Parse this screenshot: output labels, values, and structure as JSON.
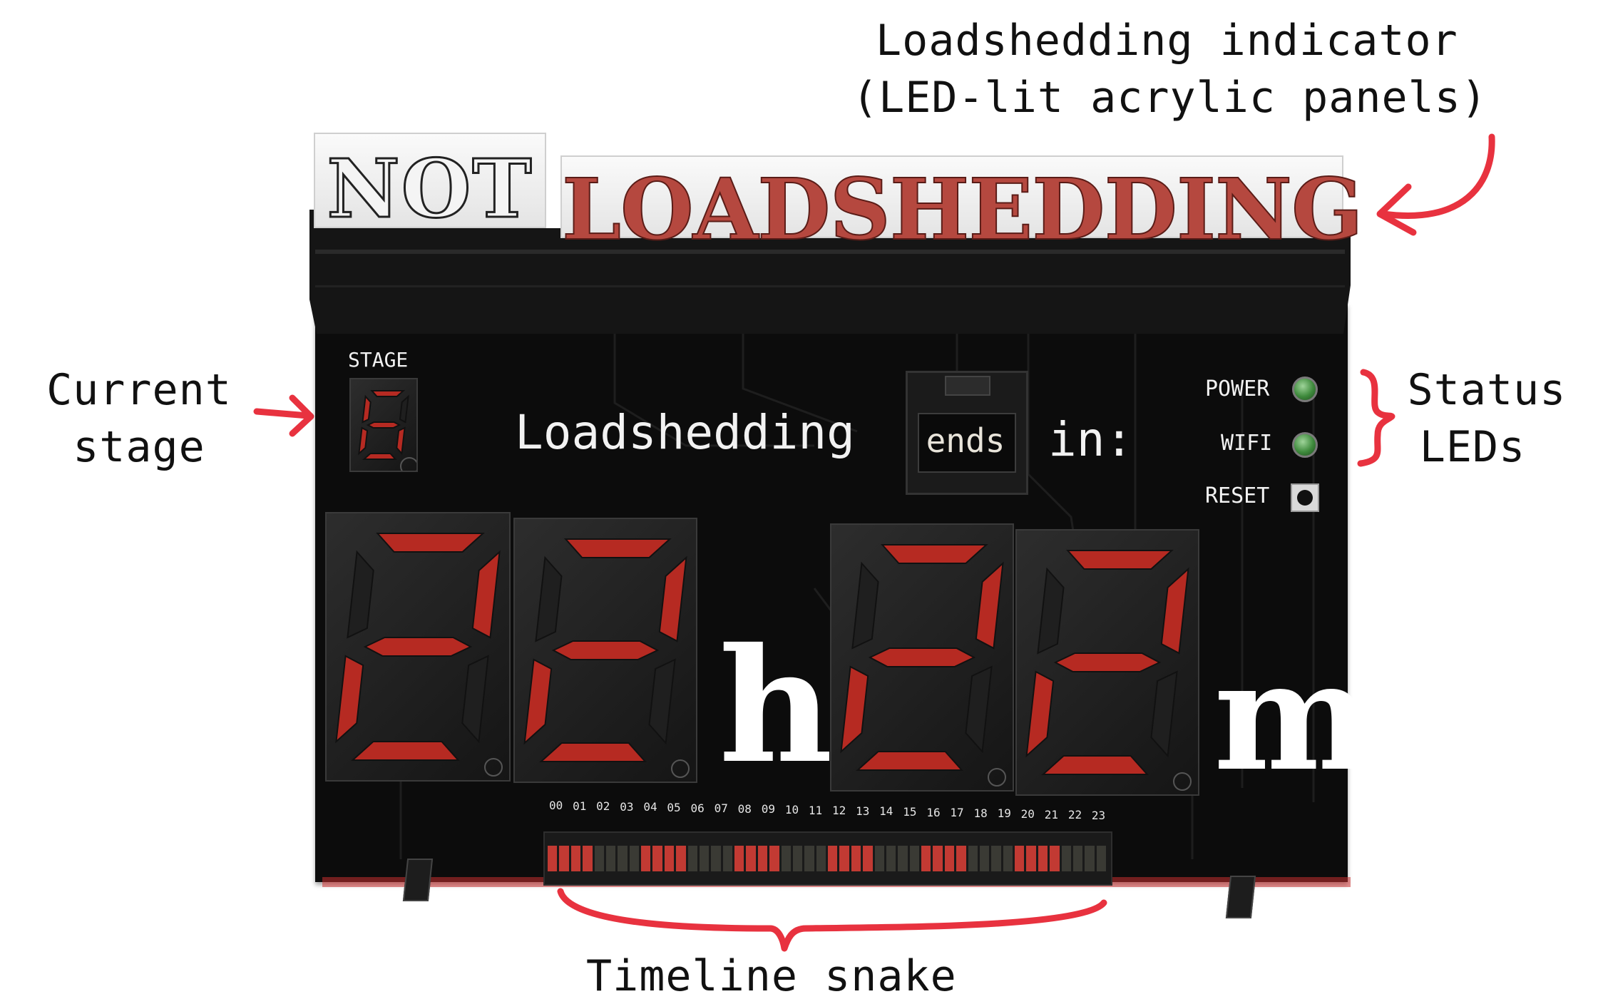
{
  "annotations": {
    "indicator_line1": "Loadshedding indicator",
    "indicator_line2": "(LED-lit acrylic panels)",
    "stage_line1": "Current",
    "stage_line2": "stage",
    "status_line1": "Status",
    "status_line2": "LEDs",
    "timeline": "Timeline snake"
  },
  "panels": {
    "not": "NOT",
    "loadshedding": "LOADSHEDDING"
  },
  "board": {
    "stage_label": "STAGE",
    "stage_value": "6",
    "headline_left": "Loadshedding",
    "headline_middle": "ends",
    "headline_right": "in:",
    "hours": "22",
    "hours_unit": "h",
    "minutes": "22",
    "minutes_unit": "m",
    "leds": [
      "POWER",
      "WIFI"
    ],
    "reset_label": "RESET"
  },
  "timeline": {
    "hours": [
      "00",
      "01",
      "02",
      "03",
      "04",
      "05",
      "06",
      "07",
      "08",
      "09",
      "10",
      "11",
      "12",
      "13",
      "14",
      "15",
      "16",
      "17",
      "18",
      "19",
      "20",
      "21",
      "22",
      "23"
    ],
    "slots_per_hour": 2,
    "lit_slots": [
      0,
      1,
      2,
      3,
      8,
      9,
      10,
      11,
      16,
      17,
      18,
      19,
      24,
      25,
      26,
      27,
      32,
      33,
      34,
      35,
      40,
      41,
      42,
      43
    ]
  },
  "colors": {
    "segment_on": "#b62a22",
    "annotation_arrow": "#e8323f",
    "board": "#0c0c0c"
  }
}
